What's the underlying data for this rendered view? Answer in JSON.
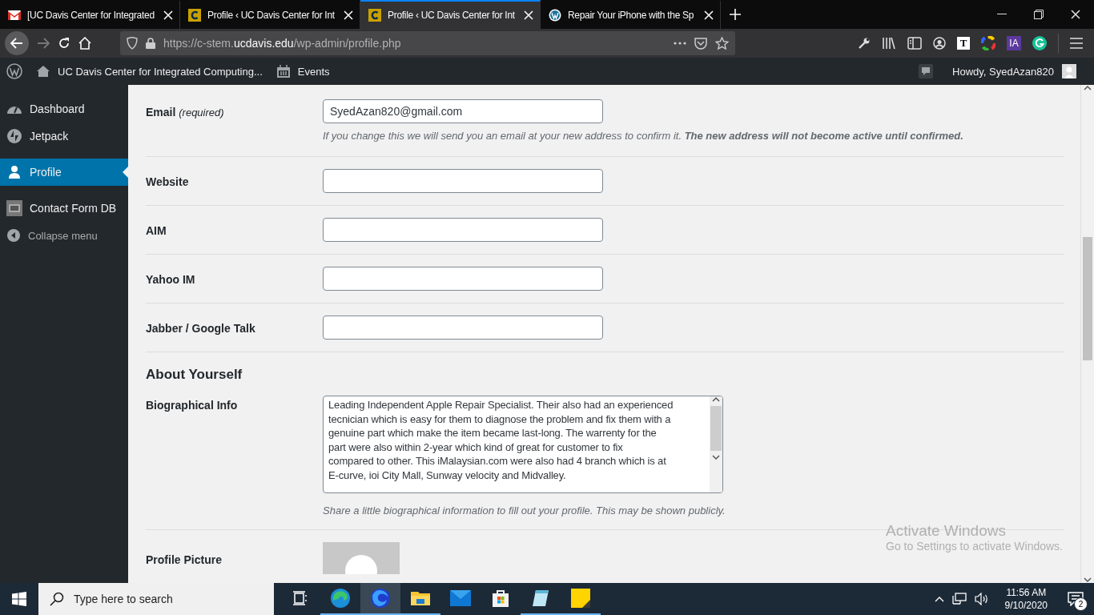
{
  "browser": {
    "tabs": [
      {
        "title": "[UC Davis Center for Integrated",
        "kind": "gmail",
        "selected": false
      },
      {
        "title": "Profile ‹ UC Davis Center for Int",
        "kind": "c-logo",
        "selected": false
      },
      {
        "title": "Profile ‹ UC Davis Center for Int",
        "kind": "c-logo",
        "selected": true
      },
      {
        "title": "Repair Your iPhone with the Sp",
        "kind": "wordpress",
        "selected": false
      }
    ],
    "url": "https://c-stem.**ucdavis.edu**/wp-admin/profile.php",
    "t_badge": "T",
    "ia_badge": "IA"
  },
  "admin_bar": {
    "site": "UC Davis Center for Integrated Computing...",
    "events": "Events",
    "greeting": "Howdy, SyedAzan820"
  },
  "sidebar": {
    "items": [
      {
        "label": "Dashboard",
        "kind": "dashboard",
        "selected": false
      },
      {
        "label": "Jetpack",
        "kind": "jetpack",
        "selected": false
      },
      {
        "label": "Profile",
        "kind": "user",
        "selected": true
      },
      {
        "label": "Contact Form DB",
        "kind": "database",
        "selected": false
      },
      {
        "label": "Collapse menu",
        "kind": "collapse",
        "selected": false
      }
    ]
  },
  "form": {
    "contact_rows": [
      {
        "label": "Email *(required)*",
        "value": "SyedAzan820@gmail.com",
        "description": "If you change this we will send you an email at your new address to confirm it. **The new address will not become active until confirmed.**"
      },
      {
        "label": "Website",
        "value": ""
      },
      {
        "label": "AIM",
        "value": ""
      },
      {
        "label": "Yahoo IM",
        "value": ""
      },
      {
        "label": "Jabber / Google Talk",
        "value": ""
      }
    ],
    "about_heading": "About Yourself",
    "bio": {
      "label": "Biographical Info",
      "lines": [
        "Leading Independent Apple Repair Specialist. Their also had an experienced",
        "tecnician which is easy for them to diagnose the problem and fix them with a",
        "genuine part which make the item became last-long. The warrenty for the",
        "part were also within 2-year which kind of great for customer to fix",
        "compared to other. This iMalaysian.com were also had 4 branch which is at",
        "E-curve, ioi City Mall, Sunway velocity and Midvalley."
      ],
      "description": "Share a little biographical information to fill out your profile. This may be shown publicly."
    },
    "picture_label": "Profile Picture"
  },
  "activation": {
    "title": "Activate Windows",
    "subtitle": "Go to Settings to activate Windows."
  },
  "taskbar": {
    "search_placeholder": "Type here to search",
    "apps": [
      {
        "kind": "task-view",
        "open": false,
        "selected": false
      },
      {
        "kind": "edge",
        "open": true,
        "selected": false
      },
      {
        "kind": "firefox",
        "open": true,
        "selected": true
      },
      {
        "kind": "explorer",
        "open": true,
        "selected": false
      },
      {
        "kind": "mail",
        "open": false,
        "selected": false
      },
      {
        "kind": "store",
        "open": false,
        "selected": false
      },
      {
        "kind": "notepad",
        "open": true,
        "selected": false
      },
      {
        "kind": "sticky",
        "open": true,
        "selected": false
      }
    ],
    "time": "11:56 AM",
    "date": "9/10/2020",
    "notifications": "2"
  }
}
